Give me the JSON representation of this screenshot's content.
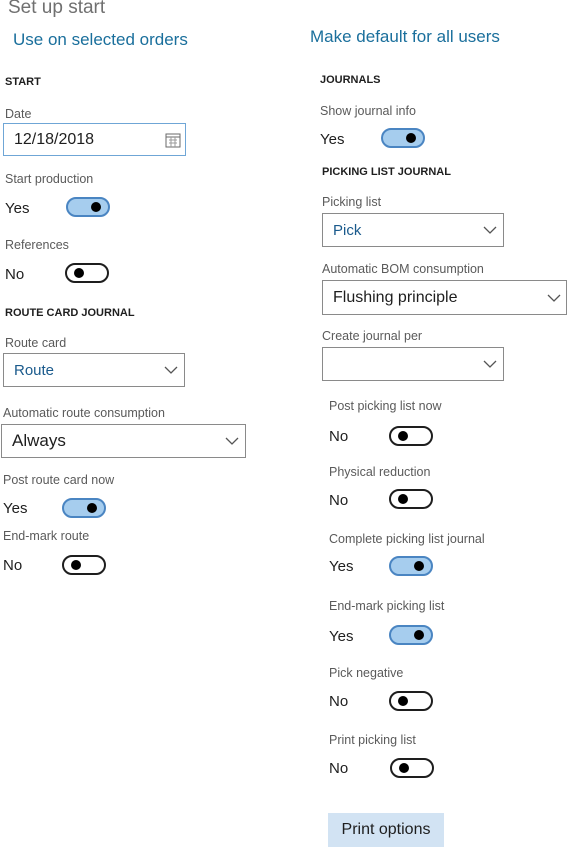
{
  "header": {
    "title": "Set up start",
    "use_selected": "Use on selected orders",
    "make_default": "Make default for all users"
  },
  "start": {
    "heading": "START",
    "date_label": "Date",
    "date_value": "12/18/2018",
    "start_production_label": "Start production",
    "start_production_value": "Yes",
    "references_label": "References",
    "references_value": "No"
  },
  "route_card_journal": {
    "heading": "ROUTE CARD JOURNAL",
    "route_card_label": "Route card",
    "route_card_value": "Route",
    "auto_route_label": "Automatic route consumption",
    "auto_route_value": "Always",
    "post_route_label": "Post route card now",
    "post_route_value": "Yes",
    "end_mark_route_label": "End-mark route",
    "end_mark_route_value": "No"
  },
  "journals": {
    "heading": "JOURNALS",
    "show_info_label": "Show journal info",
    "show_info_value": "Yes"
  },
  "picking_list_journal": {
    "heading": "PICKING LIST JOURNAL",
    "picking_list_label": "Picking list",
    "picking_list_value": "Pick",
    "auto_bom_label": "Automatic BOM consumption",
    "auto_bom_value": "Flushing principle",
    "create_per_label": "Create journal per",
    "create_per_value": "",
    "post_now_label": "Post picking list now",
    "post_now_value": "No",
    "physical_label": "Physical reduction",
    "physical_value": "No",
    "complete_label": "Complete picking list journal",
    "complete_value": "Yes",
    "end_mark_label": "End-mark picking list",
    "end_mark_value": "Yes",
    "negative_label": "Pick negative",
    "negative_value": "No",
    "print_label": "Print picking list",
    "print_value": "No"
  },
  "print_options": "Print options",
  "icons": {
    "calendar": "calendar-icon",
    "dropdown": "chevron-down-icon"
  },
  "colors": {
    "link": "#1a6f9c",
    "toggle_on_fill": "#a6cdee",
    "toggle_on_border": "#4a85c2",
    "button": "#d2e3f3"
  }
}
